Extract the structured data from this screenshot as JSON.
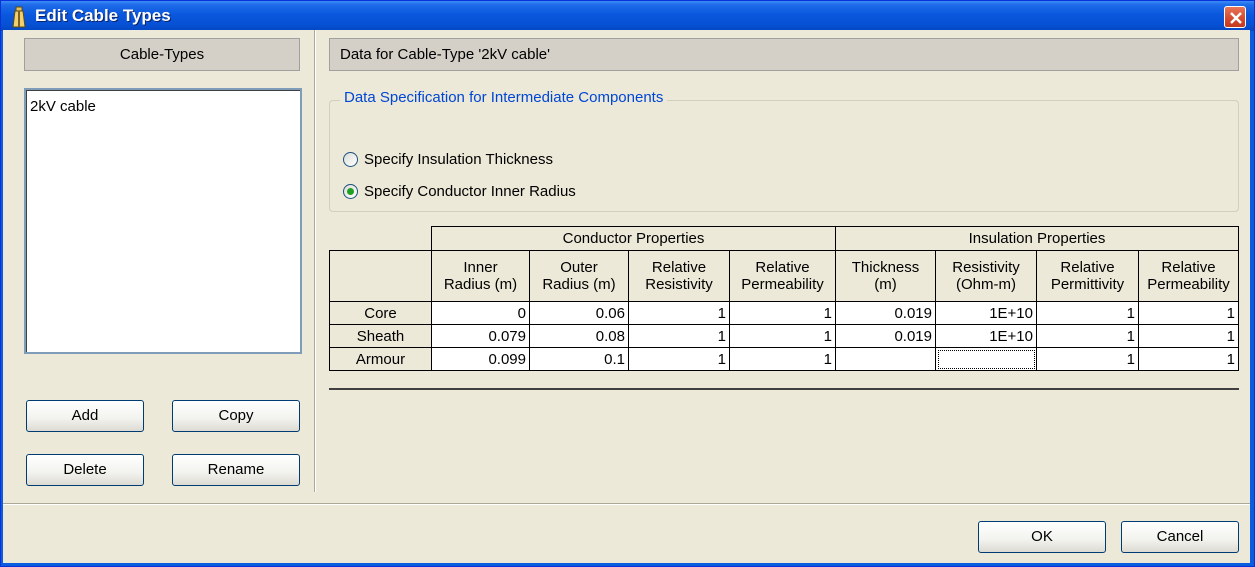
{
  "window": {
    "title": "Edit Cable Types"
  },
  "left_panel": {
    "header": "Cable-Types",
    "items": [
      "2kV cable"
    ],
    "buttons": {
      "add": "Add",
      "copy": "Copy",
      "delete": "Delete",
      "rename": "Rename"
    }
  },
  "right_panel": {
    "header": "Data for Cable-Type '2kV cable'",
    "group": {
      "title": "Data Specification for Intermediate Components",
      "options": [
        "Specify Insulation Thickness",
        "Specify Conductor Inner Radius"
      ],
      "selected": "Specify Conductor Inner Radius"
    },
    "table": {
      "group_headers": [
        "Conductor Properties",
        "Insulation Properties"
      ],
      "columns": [
        [
          "Inner",
          "Radius (m)"
        ],
        [
          "Outer",
          "Radius (m)"
        ],
        [
          "Relative",
          "Resistivity"
        ],
        [
          "Relative",
          "Permeability"
        ],
        [
          "Thickness",
          "(m)"
        ],
        [
          "Resistivity",
          "(Ohm-m)"
        ],
        [
          "Relative",
          "Permittivity"
        ],
        [
          "Relative",
          "Permeability"
        ]
      ],
      "rows": [
        {
          "label": "Core",
          "values": [
            "0",
            "0.06",
            "1",
            "1",
            "0.019",
            "1E+10",
            "1",
            "1"
          ]
        },
        {
          "label": "Sheath",
          "values": [
            "0.079",
            "0.08",
            "1",
            "1",
            "0.019",
            "1E+10",
            "1",
            "1"
          ]
        },
        {
          "label": "Armour",
          "values": [
            "0.099",
            "0.1",
            "1",
            "1",
            "",
            "",
            "1",
            "1"
          ]
        }
      ]
    }
  },
  "footer": {
    "ok": "OK",
    "cancel": "Cancel"
  },
  "colors": {
    "title_bar": "#0a58de",
    "dialog_bg": "#ece9d8",
    "group_label": "#0046d5",
    "close_button": "#d5492d"
  }
}
